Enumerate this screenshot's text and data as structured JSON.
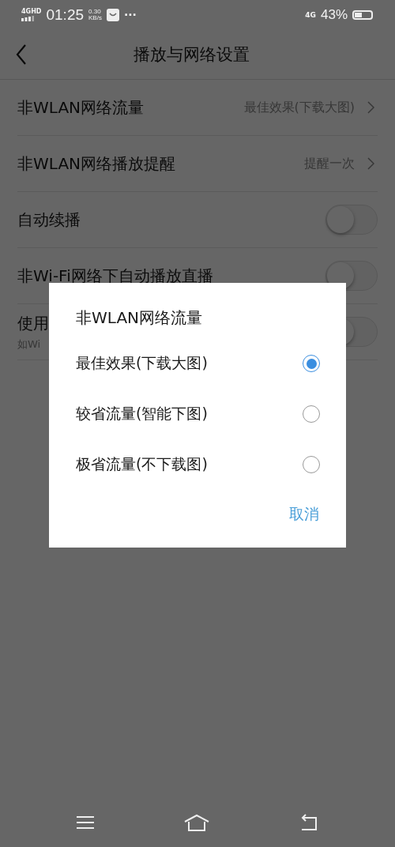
{
  "status_bar": {
    "network": "4G",
    "network_badge": "HD",
    "time": "01:25",
    "speed_value": "0.30",
    "speed_unit": "KB/s",
    "more": "···",
    "data_type": "4G",
    "battery": "43%"
  },
  "header": {
    "title": "播放与网络设置"
  },
  "settings": [
    {
      "kind": "link",
      "label": "非WLAN网络流量",
      "value": "最佳效果(下载大图)"
    },
    {
      "kind": "link",
      "label": "非WLAN网络播放提醒",
      "value": "提醒一次"
    },
    {
      "kind": "toggle",
      "label": "自动续播",
      "on": false
    },
    {
      "kind": "toggle",
      "label": "非Wi-Fi网络下自动播放直播",
      "on": false
    },
    {
      "kind": "toggle",
      "label": "使用",
      "subtitle": "如Wi",
      "on": false
    }
  ],
  "dialog": {
    "title": "非WLAN网络流量",
    "options": [
      {
        "label": "最佳效果(下载大图)",
        "selected": true
      },
      {
        "label": "较省流量(智能下图)",
        "selected": false
      },
      {
        "label": "极省流量(不下载图)",
        "selected": false
      }
    ],
    "cancel": "取消"
  }
}
